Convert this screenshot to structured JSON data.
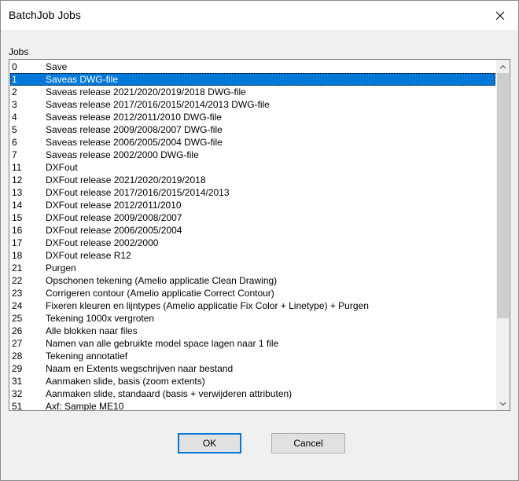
{
  "window": {
    "title": "BatchJob Jobs"
  },
  "group_label": "Jobs",
  "jobs": [
    {
      "id": "0",
      "name": "Save"
    },
    {
      "id": "1",
      "name": "Saveas DWG-file",
      "selected": true
    },
    {
      "id": "2",
      "name": "Saveas release 2021/2020/2019/2018 DWG-file"
    },
    {
      "id": "3",
      "name": "Saveas release 2017/2016/2015/2014/2013 DWG-file"
    },
    {
      "id": "4",
      "name": "Saveas release 2012/2011/2010 DWG-file"
    },
    {
      "id": "5",
      "name": "Saveas release 2009/2008/2007 DWG-file"
    },
    {
      "id": "6",
      "name": "Saveas release 2006/2005/2004 DWG-file"
    },
    {
      "id": "7",
      "name": "Saveas release 2002/2000 DWG-file"
    },
    {
      "id": "11",
      "name": "DXFout"
    },
    {
      "id": "12",
      "name": "DXFout release 2021/2020/2019/2018"
    },
    {
      "id": "13",
      "name": "DXFout release 2017/2016/2015/2014/2013"
    },
    {
      "id": "14",
      "name": "DXFout release 2012/2011/2010"
    },
    {
      "id": "15",
      "name": "DXFout release 2009/2008/2007"
    },
    {
      "id": "16",
      "name": "DXFout release 2006/2005/2004"
    },
    {
      "id": "17",
      "name": "DXFout release 2002/2000"
    },
    {
      "id": "18",
      "name": "DXFout release R12"
    },
    {
      "id": "21",
      "name": "Purgen"
    },
    {
      "id": "22",
      "name": "Opschonen tekening (Amelio applicatie Clean Drawing)"
    },
    {
      "id": "23",
      "name": "Corrigeren contour (Amelio applicatie Correct Contour)"
    },
    {
      "id": "24",
      "name": "Fixeren kleuren en lijntypes (Amelio applicatie Fix Color + Linetype) + Purgen"
    },
    {
      "id": "25",
      "name": "Tekening 1000x vergroten"
    },
    {
      "id": "26",
      "name": "Alle blokken naar files"
    },
    {
      "id": "27",
      "name": "Namen van alle gebruikte model space lagen naar 1 file"
    },
    {
      "id": "28",
      "name": "Tekening annotatief"
    },
    {
      "id": "29",
      "name": "Naam en Extents wegschrijven naar bestand"
    },
    {
      "id": "31",
      "name": "Aanmaken slide, basis (zoom extents)"
    },
    {
      "id": "32",
      "name": "Aanmaken slide, standaard (basis + verwijderen attributen)"
    },
    {
      "id": "51",
      "name": "Axf: Sample ME10"
    }
  ],
  "buttons": {
    "ok": "OK",
    "cancel": "Cancel"
  },
  "icons": {
    "close": "close-icon",
    "scroll_up": "chevron-up-icon",
    "scroll_down": "chevron-down-icon"
  },
  "colors": {
    "selection": "#0078d7",
    "default_button_border": "#0078d7"
  }
}
